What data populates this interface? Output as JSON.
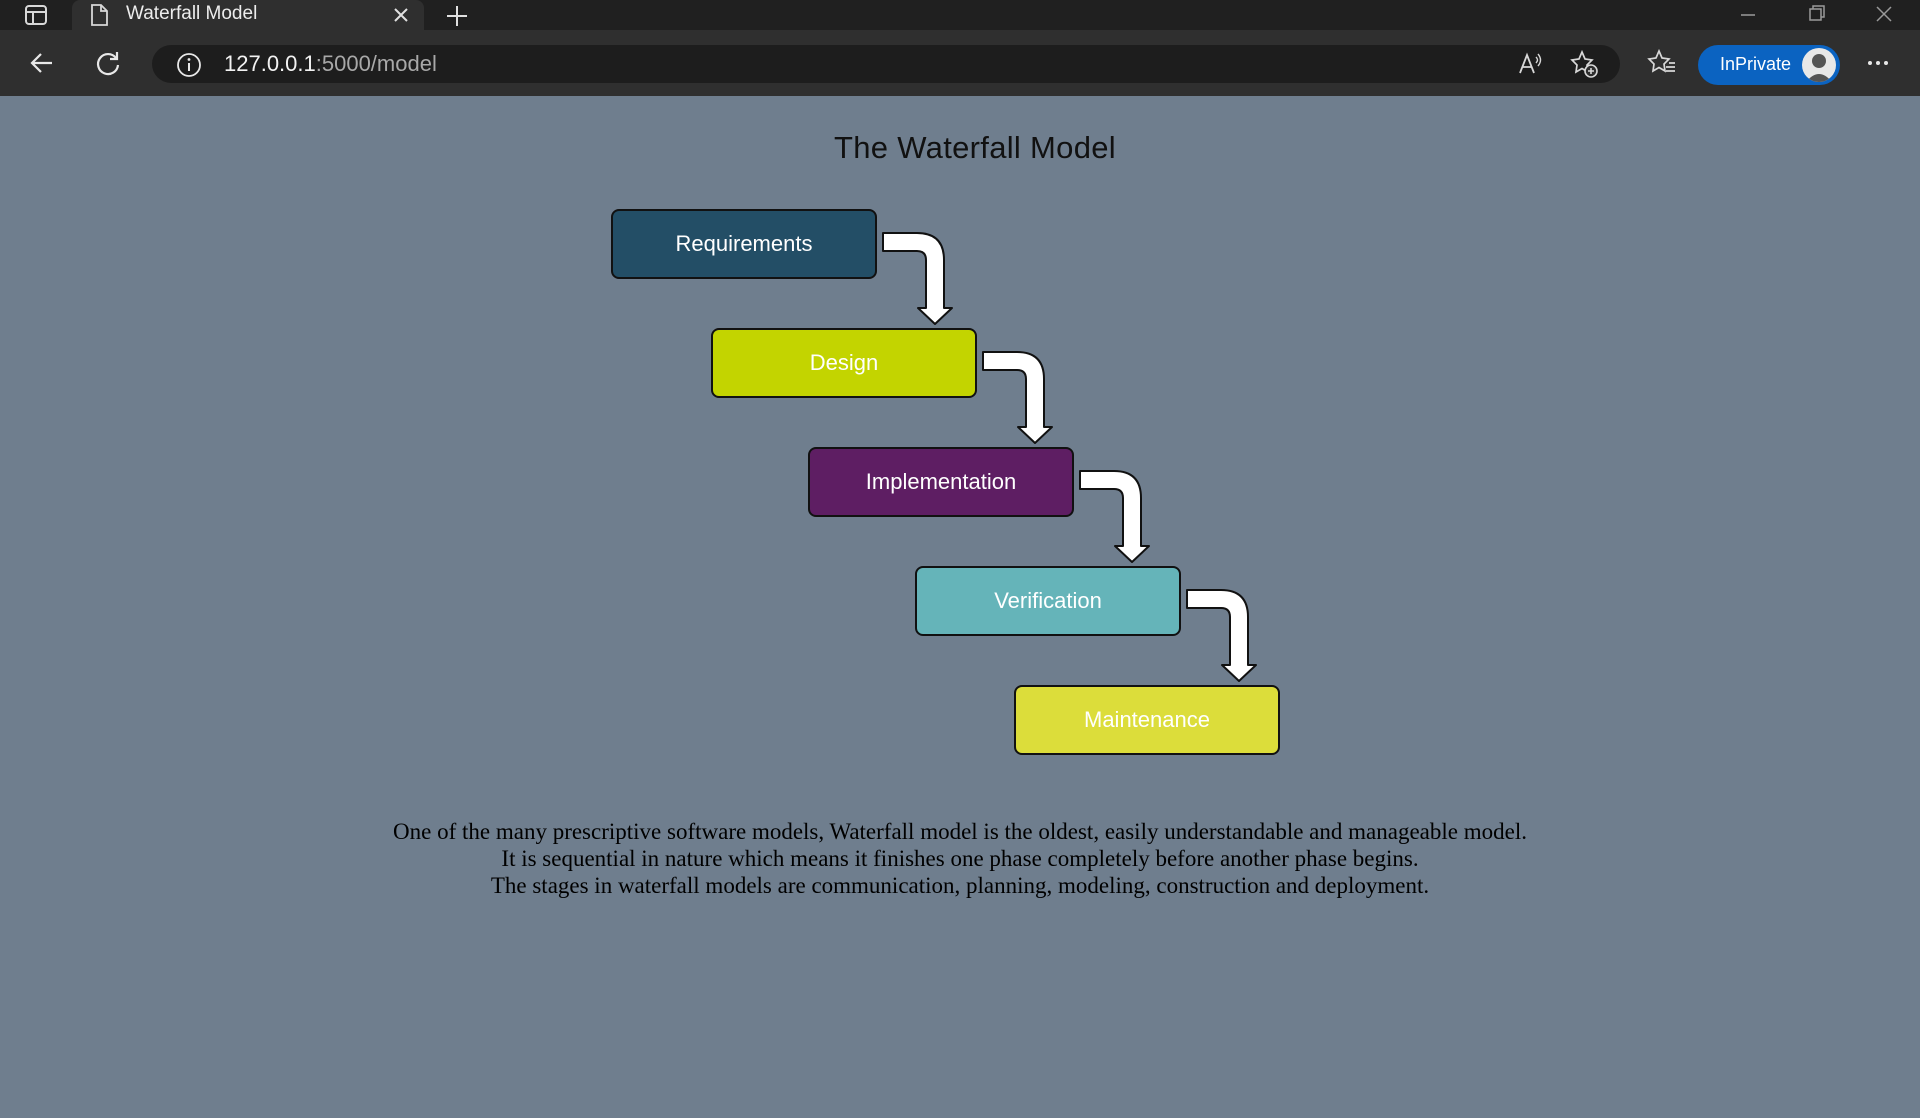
{
  "browser": {
    "tab_title": "Waterfall Model",
    "url_host": "127.0.0.1",
    "url_path": ":5000/model",
    "inprivate_label": "InPrivate"
  },
  "page": {
    "title": "The Waterfall Model",
    "phases": [
      {
        "label": "Requirements",
        "color": "#234e66"
      },
      {
        "label": "Design",
        "color": "#c3d400"
      },
      {
        "label": "Implementation",
        "color": "#5e1e63"
      },
      {
        "label": "Verification",
        "color": "#65b4b9"
      },
      {
        "label": "Maintenance",
        "color": "#dcdd3a"
      }
    ],
    "description": [
      "One of the many prescriptive software models, Waterfall model is the oldest, easily understandable and manageable model.",
      "It is sequential in nature which means it finishes one phase completely before another phase begins.",
      "The stages in waterfall models are communication, planning, modeling, construction and deployment."
    ]
  }
}
